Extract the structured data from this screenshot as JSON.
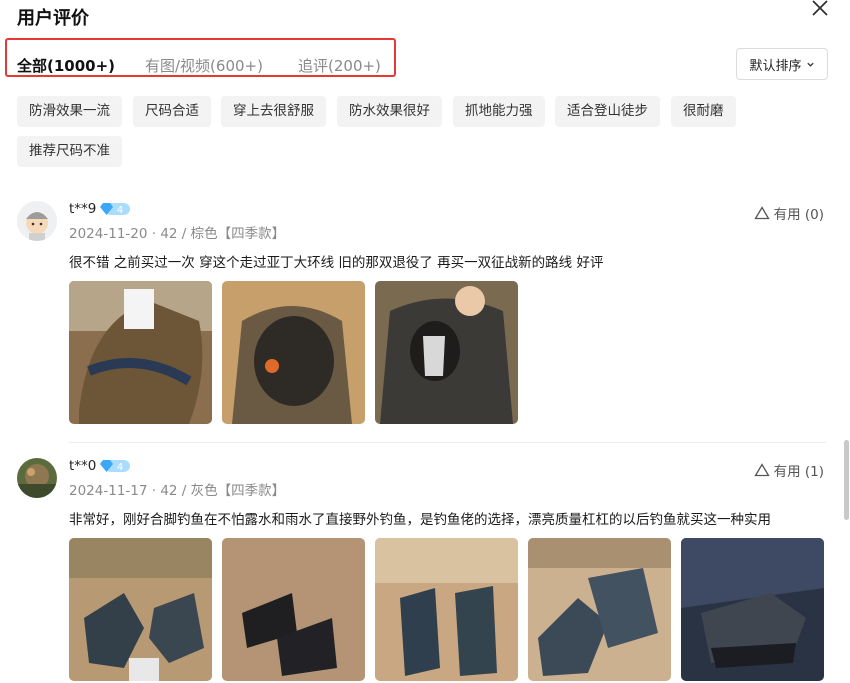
{
  "header": {
    "title": "用户评价"
  },
  "tabs": [
    {
      "label": "全部(1000+)"
    },
    {
      "label": "有图/视频(600+)"
    },
    {
      "label": "追评(200+)"
    }
  ],
  "sort": {
    "label": "默认排序"
  },
  "tags": [
    "防滑效果一流",
    "尺码合适",
    "穿上去很舒服",
    "防水效果很好",
    "抓地能力强",
    "适合登山徒步",
    "很耐磨",
    "推荐尺码不准"
  ],
  "reviews": [
    {
      "user": "t**9",
      "level": "4",
      "meta": "2024-11-20 · 42 / 棕色【四季款】",
      "content": "很不错 之前买过一次 穿这个走过亚丁大环线 旧的那双退役了 再买一双征战新的路线 好评",
      "useful": "有用 (0)",
      "photo_count": 3
    },
    {
      "user": "t**0",
      "level": "4",
      "meta": "2024-11-17 · 42 / 灰色【四季款】",
      "content": "非常好，刚好合脚钓鱼在不怕露水和雨水了直接野外钓鱼，是钓鱼佬的选择，漂亮质量杠杠的以后钓鱼就买这一种实用",
      "useful": "有用 (1)",
      "photo_count": 5
    }
  ],
  "colors": {
    "highlight_box": "#e53935",
    "tag_bg": "#f3f3f3",
    "vip_badge": "#6ec3ff"
  }
}
